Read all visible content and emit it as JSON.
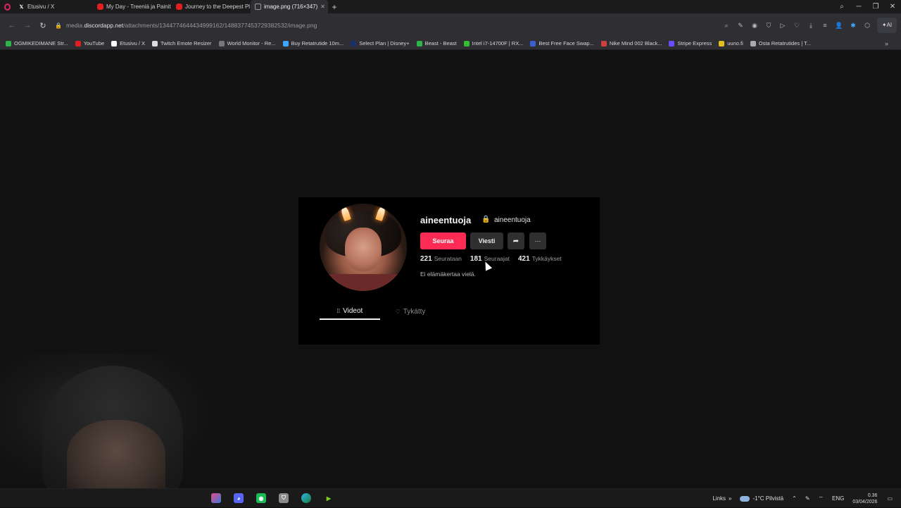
{
  "browser": {
    "tabs": [
      {
        "label": "Etusivu / X",
        "icon": "x-icon"
      },
      {
        "label": "My Day - Treeniä ja Painit",
        "icon": "youtube-icon"
      },
      {
        "label": "Journey to the Deepest Pl",
        "icon": "youtube-icon"
      },
      {
        "label": "image.png (716×347)",
        "icon": "image-icon",
        "active": true
      }
    ],
    "url": {
      "prefix": "media.",
      "domain": "discordapp.net",
      "path": "/attachments/1344774644434999162/1488377453729382532/image.png"
    },
    "bookmarks": [
      {
        "label": "OGMIKEDIMANE Str...",
        "color": "#2db34a"
      },
      {
        "label": "YouTube",
        "color": "#e02020"
      },
      {
        "label": "Etusivu / X",
        "color": "#ffffff"
      },
      {
        "label": "Twitch Emote Resizer",
        "color": "#dddddd"
      },
      {
        "label": "World Monitor - Re...",
        "color": "#777777"
      },
      {
        "label": "Buy Retatrutide 10m...",
        "color": "#3ea6ff"
      },
      {
        "label": "Select Plan | Disney+",
        "color": "#1b2f6a"
      },
      {
        "label": "Beast - Beast",
        "color": "#2db34a"
      },
      {
        "label": "Intel i7-14700F | RX...",
        "color": "#30c030"
      },
      {
        "label": "Best Free Face Swap...",
        "color": "#3a5fd0"
      },
      {
        "label": "Nike Mind 002 Black...",
        "color": "#d04040"
      },
      {
        "label": "Stripe Express",
        "color": "#6a4cff"
      },
      {
        "label": "uuno.fi",
        "color": "#e0c020"
      },
      {
        "label": "Osta Retatrutides | T...",
        "color": "#aaaaaa"
      }
    ]
  },
  "profile": {
    "display_name": "aineentuoja",
    "handle": "aineentuoja",
    "follow_label": "Seuraa",
    "message_label": "Viesti",
    "stats": [
      {
        "value": "221",
        "label": "Seurataan"
      },
      {
        "value": "181",
        "label": "Seuraajat"
      },
      {
        "value": "421",
        "label": "Tykkäykset"
      }
    ],
    "bio": "Ei elämäkertaa vielä.",
    "tabs": [
      {
        "label": "Videot",
        "active": true
      },
      {
        "label": "Tykätty",
        "active": false
      }
    ]
  },
  "taskbar": {
    "links_label": "Links",
    "weather": "-1°C  Pilvistä",
    "language": "ENG",
    "time": "0.36",
    "date": "03/04/2026"
  }
}
